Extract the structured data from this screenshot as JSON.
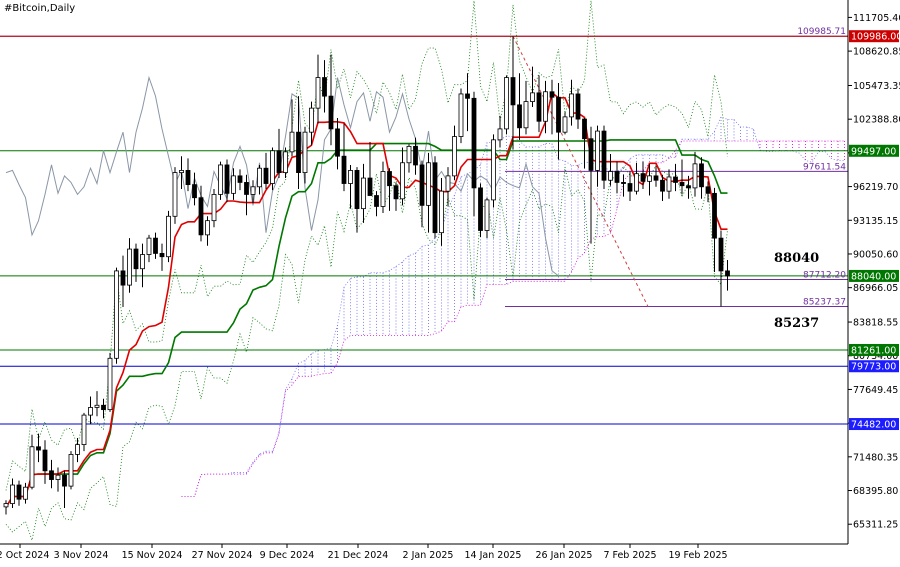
{
  "chart_data": {
    "type": "candlestick",
    "title": "#Bitcoin,Daily",
    "ylim": [
      63500,
      113300
    ],
    "yticks": [
      "111705.40",
      "108620.85",
      "105473.35",
      "102388.80",
      "99304.25",
      "96219.70",
      "93135.15",
      "90050.60",
      "86966.05",
      "83818.55",
      "80734.00",
      "77649.45",
      "74565.00",
      "71480.35",
      "68395.80",
      "65311.25"
    ],
    "xticks": [
      "22 Oct 2024",
      "3 Nov 2024",
      "15 Nov 2024",
      "27 Nov 2024",
      "9 Dec 2024",
      "21 Dec 2024",
      "2 Jan 2025",
      "14 Jan 2025",
      "26 Jan 2025",
      "7 Feb 2025",
      "19 Feb 2025"
    ],
    "candles": [
      [
        66900,
        67500,
        66200,
        67200
      ],
      [
        67200,
        69500,
        66800,
        68900
      ],
      [
        68900,
        69300,
        67000,
        67600
      ],
      [
        67600,
        69100,
        67200,
        68700
      ],
      [
        68700,
        73500,
        68500,
        72400
      ],
      [
        72400,
        73600,
        71000,
        72100
      ],
      [
        72100,
        73000,
        69000,
        70200
      ],
      [
        70200,
        71200,
        68600,
        69400
      ],
      [
        69400,
        70500,
        68300,
        69800
      ],
      [
        69800,
        70200,
        66800,
        68800
      ],
      [
        68800,
        72000,
        68500,
        71700
      ],
      [
        71700,
        73200,
        71000,
        72600
      ],
      [
        72600,
        75500,
        72000,
        75300
      ],
      [
        75300,
        77000,
        74500,
        76000
      ],
      [
        76000,
        77500,
        75200,
        76200
      ],
      [
        76200,
        76800,
        75000,
        75800
      ],
      [
        75800,
        81000,
        75600,
        80500
      ],
      [
        80500,
        88800,
        80000,
        88500
      ],
      [
        88500,
        89900,
        85200,
        87200
      ],
      [
        87200,
        91500,
        86500,
        90500
      ],
      [
        90500,
        91000,
        87500,
        88700
      ],
      [
        88700,
        91000,
        87000,
        90000
      ],
      [
        90000,
        91800,
        89300,
        91500
      ],
      [
        91500,
        92000,
        89600,
        90100
      ],
      [
        90100,
        91000,
        88500,
        89800
      ],
      [
        89800,
        94000,
        89300,
        93500
      ],
      [
        93500,
        98000,
        92800,
        97500
      ],
      [
        97500,
        99000,
        96000,
        97700
      ],
      [
        97700,
        98800,
        95800,
        96400
      ],
      [
        96400,
        97500,
        94500,
        95200
      ],
      [
        95200,
        96300,
        91200,
        91800
      ],
      [
        91800,
        93500,
        90800,
        93100
      ],
      [
        93100,
        96000,
        92500,
        95500
      ],
      [
        95500,
        98500,
        95000,
        98200
      ],
      [
        98200,
        98700,
        94800,
        95600
      ],
      [
        95600,
        97900,
        95000,
        97200
      ],
      [
        97200,
        97800,
        95900,
        96600
      ],
      [
        96600,
        97300,
        93600,
        95500
      ],
      [
        95500,
        96800,
        94700,
        96200
      ],
      [
        96200,
        98200,
        95500,
        97900
      ],
      [
        97900,
        99300,
        96000,
        96500
      ],
      [
        96500,
        99800,
        95900,
        99500
      ],
      [
        99500,
        101500,
        97000,
        97500
      ],
      [
        97500,
        99800,
        97000,
        99400
      ],
      [
        99400,
        104200,
        99000,
        101200
      ],
      [
        101200,
        104500,
        96000,
        97500
      ],
      [
        97500,
        101700,
        96500,
        101200
      ],
      [
        101200,
        104000,
        100000,
        103400
      ],
      [
        103400,
        108300,
        102000,
        106200
      ],
      [
        106200,
        107800,
        103000,
        104500
      ],
      [
        104500,
        108300,
        100000,
        101500
      ],
      [
        101500,
        102500,
        97800,
        99000
      ],
      [
        99000,
        102000,
        95800,
        96500
      ],
      [
        96500,
        98200,
        94200,
        97700
      ],
      [
        97700,
        98000,
        92000,
        94200
      ],
      [
        94200,
        98300,
        92900,
        97000
      ],
      [
        97000,
        100300,
        95800,
        95400
      ],
      [
        95400,
        95800,
        93500,
        94400
      ],
      [
        94400,
        98500,
        93800,
        97600
      ],
      [
        97600,
        97900,
        94000,
        96300
      ],
      [
        96300,
        96600,
        94000,
        95100
      ],
      [
        95100,
        99800,
        94500,
        98400
      ],
      [
        98400,
        100100,
        97500,
        99900
      ],
      [
        99900,
        100700,
        97300,
        98200
      ],
      [
        98200,
        98600,
        92500,
        94500
      ],
      [
        94500,
        99300,
        92000,
        98400
      ],
      [
        98400,
        99000,
        91500,
        92000
      ],
      [
        92000,
        97000,
        90800,
        95800
      ],
      [
        95800,
        98000,
        94400,
        97200
      ],
      [
        97200,
        101800,
        96800,
        100800
      ],
      [
        100800,
        105200,
        100200,
        104700
      ],
      [
        104700,
        106600,
        101300,
        104300
      ],
      [
        104300,
        104900,
        93500,
        96100
      ],
      [
        96100,
        96500,
        91600,
        92200
      ],
      [
        92200,
        95200,
        91500,
        95000
      ],
      [
        95000,
        101000,
        94300,
        100500
      ],
      [
        100500,
        102700,
        99800,
        101500
      ],
      [
        101500,
        106400,
        101000,
        106200
      ],
      [
        106200,
        109986,
        99600,
        103700
      ],
      [
        103700,
        106600,
        100500,
        101600
      ],
      [
        101600,
        105900,
        101000,
        104000
      ],
      [
        104000,
        107200,
        103500,
        104800
      ],
      [
        104800,
        106400,
        101200,
        102200
      ],
      [
        102200,
        105900,
        101100,
        104900
      ],
      [
        104900,
        106000,
        101000,
        104400
      ],
      [
        104400,
        105700,
        98700,
        101200
      ],
      [
        101200,
        103000,
        101000,
        102600
      ],
      [
        102600,
        106000,
        101800,
        104700
      ],
      [
        104700,
        105200,
        101500,
        102400
      ],
      [
        102400,
        102500,
        97900,
        100600
      ],
      [
        100600,
        101700,
        91000,
        97700
      ],
      [
        97700,
        101800,
        96200,
        101300
      ],
      [
        101300,
        101800,
        96000,
        96800
      ],
      [
        96800,
        99200,
        96300,
        97600
      ],
      [
        97600,
        98500,
        95600,
        96600
      ],
      [
        96600,
        97300,
        95300,
        96500
      ],
      [
        96500,
        97600,
        94900,
        95800
      ],
      [
        95800,
        98400,
        95500,
        97400
      ],
      [
        97400,
        98500,
        96000,
        96700
      ],
      [
        96700,
        98300,
        95400,
        97200
      ],
      [
        97200,
        98100,
        96200,
        96800
      ],
      [
        96800,
        97300,
        94900,
        95800
      ],
      [
        95800,
        97800,
        95100,
        97100
      ],
      [
        97100,
        98300,
        95800,
        96600
      ],
      [
        96600,
        98700,
        95500,
        96300
      ],
      [
        96300,
        97200,
        95100,
        96100
      ],
      [
        96100,
        99400,
        95300,
        98300
      ],
      [
        98300,
        98900,
        95100,
        96200
      ],
      [
        96200,
        96700,
        94800,
        95600
      ],
      [
        95600,
        96100,
        88400,
        91500
      ],
      [
        91500,
        92200,
        85237,
        88500
      ],
      [
        88500,
        89500,
        86700,
        88040
      ]
    ],
    "levels": [
      {
        "value": "109985.71",
        "color": "#7030a0"
      },
      {
        "value": "109986.00",
        "color": "#c00000"
      },
      {
        "value": "99497.00",
        "color": "#007700"
      },
      {
        "value": "97611.54",
        "color": "#7030a0"
      },
      {
        "value": "88040.00",
        "color": "#007700"
      },
      {
        "value": "87712.20",
        "color": "#7030a0"
      },
      {
        "value": "85237.37",
        "color": "#7030a0"
      },
      {
        "value": "81261.00",
        "color": "#007700"
      },
      {
        "value": "79773.00",
        "color": "#0000cc"
      },
      {
        "value": "74482.00",
        "color": "#0000cc"
      }
    ],
    "annotations": [
      "88040",
      "85237"
    ],
    "colors": {
      "tenkan": "#e00000",
      "kijun": "#007700",
      "chikou": "#8a96a6",
      "cloud": "#e000e0",
      "cloud_lower": "#6b6bf0",
      "levels_green": "#007700",
      "levels_blue": "#0000cc",
      "levels_purple": "#7030a0",
      "levels_red": "#c00000",
      "axis_tag_green": "#007700",
      "axis_tag_blue": "#1c1cff",
      "axis_tag_red": "#cc0000",
      "trend_dashed": "#d04040"
    }
  }
}
